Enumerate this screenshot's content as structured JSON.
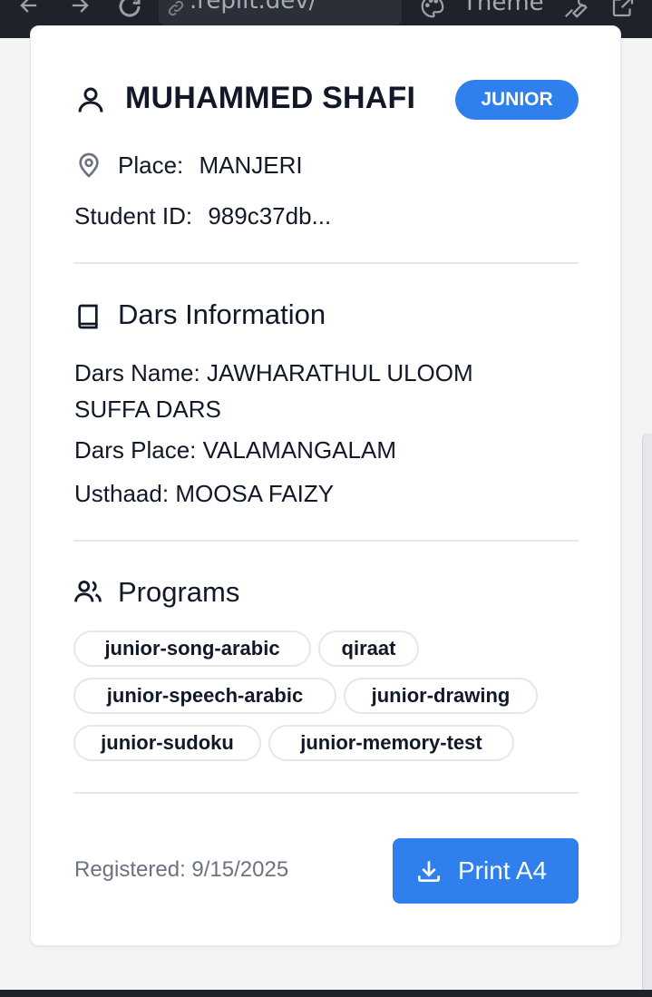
{
  "browser": {
    "url_text": ".replit.dev/",
    "theme_label": "Theme"
  },
  "student": {
    "name": "MUHAMMED SHAFI",
    "category_badge": "JUNIOR",
    "place_label": "Place:",
    "place_value": "MANJERI",
    "id_label": "Student ID:",
    "id_value": "989c37db..."
  },
  "dars": {
    "section_title": "Dars Information",
    "name_label": "Dars Name:",
    "name_value_line1": "JAWHARATHUL ULOOM",
    "name_value_line2": "SUFFA DARS",
    "place_label": "Dars Place:",
    "place_value": "VALAMANGALAM",
    "usthaad_label": "Usthaad:",
    "usthaad_value": "MOOSA FAIZY"
  },
  "programs": {
    "section_title": "Programs",
    "items": [
      "junior-song-arabic",
      "qiraat",
      "junior-speech-arabic",
      "junior-drawing",
      "junior-sudoku",
      "junior-memory-test"
    ]
  },
  "footer": {
    "registered_text": "Registered: 9/15/2025",
    "print_button_label": "Print A4"
  },
  "colors": {
    "accent": "#2f80ed",
    "topbar": "#1f2329"
  }
}
